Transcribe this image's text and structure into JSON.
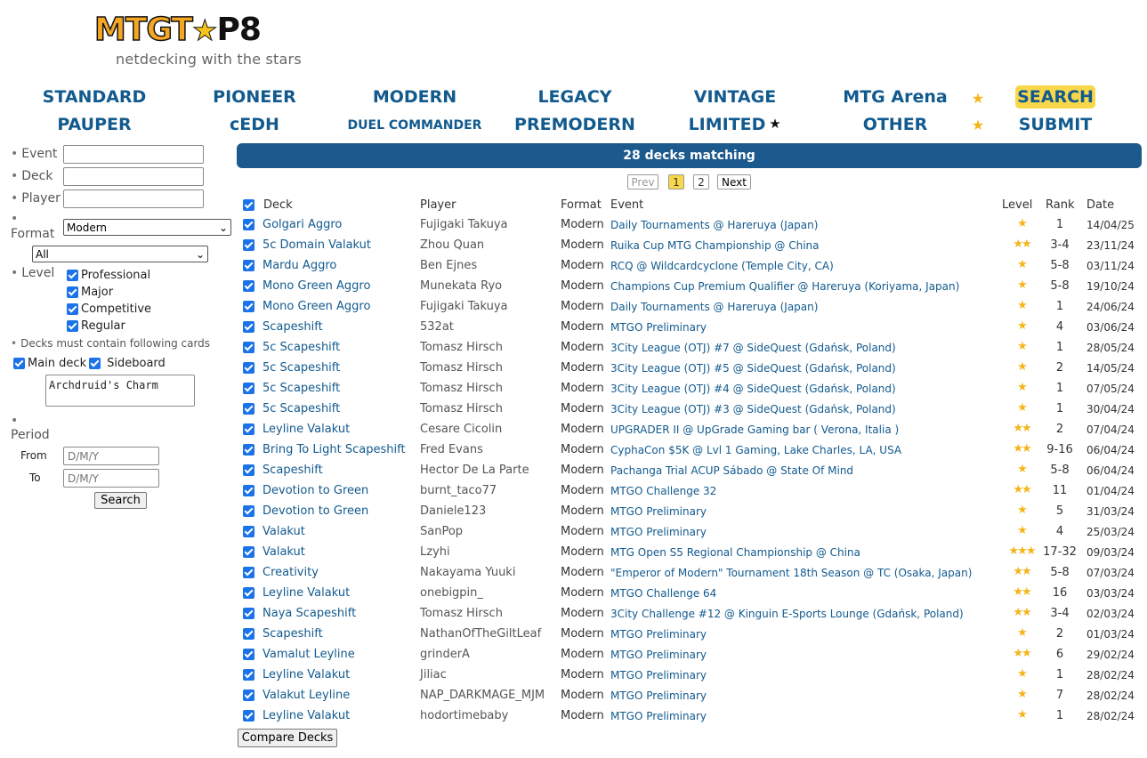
{
  "logo": {
    "part1": "MTG",
    "part2": "T",
    "part3": "P8",
    "tagline": "netdecking with the stars"
  },
  "nav": {
    "row1": [
      "STANDARD",
      "PIONEER",
      "MODERN",
      "LEGACY",
      "VINTAGE",
      "MTG Arena",
      "SEARCH"
    ],
    "row2": [
      "PAUPER",
      "cEDH",
      "DUEL COMMANDER",
      "PREMODERN",
      "LIMITED",
      "OTHER",
      "SUBMIT"
    ]
  },
  "sidebar": {
    "event_label": "Event",
    "deck_label": "Deck",
    "player_label": "Player",
    "format_label": "Format",
    "format_value": "Modern",
    "subformat_value": "All",
    "level_label": "Level",
    "levels": [
      "Professional",
      "Major",
      "Competitive",
      "Regular"
    ],
    "cards_label": "Decks must contain following cards",
    "main_deck_label": "Main deck",
    "sideboard_label": "Sideboard",
    "cards_value": "Archdruid's Charm",
    "period_label": "Period",
    "from_label": "From",
    "to_label": "To",
    "date_placeholder": "D/M/Y",
    "search_button": "Search"
  },
  "results": {
    "banner": "28 decks matching",
    "pagination": {
      "prev": "Prev",
      "page1": "1",
      "page2": "2",
      "next": "Next"
    },
    "headers": {
      "deck": "Deck",
      "player": "Player",
      "format": "Format",
      "event": "Event",
      "level": "Level",
      "rank": "Rank",
      "date": "Date"
    },
    "rows": [
      {
        "deck": "Golgari Aggro",
        "player": "Fujigaki Takuya",
        "format": "Modern",
        "event": "Daily Tournaments @ Hareruya (Japan)",
        "level": "★",
        "rank": "1",
        "date": "14/04/25"
      },
      {
        "deck": "5c Domain Valakut",
        "player": "Zhou Quan",
        "format": "Modern",
        "event": "Ruika Cup MTG Championship @ China",
        "level": "★★",
        "rank": "3-4",
        "date": "23/11/24"
      },
      {
        "deck": "Mardu Aggro",
        "player": "Ben Ejnes",
        "format": "Modern",
        "event": "RCQ @ Wildcardcyclone (Temple City, CA)",
        "level": "★",
        "rank": "5-8",
        "date": "03/11/24"
      },
      {
        "deck": "Mono Green Aggro",
        "player": "Munekata Ryo",
        "format": "Modern",
        "event": "Champions Cup Premium Qualifier @ Hareruya (Koriyama, Japan)",
        "level": "★",
        "rank": "5-8",
        "date": "19/10/24"
      },
      {
        "deck": "Mono Green Aggro",
        "player": "Fujigaki Takuya",
        "format": "Modern",
        "event": "Daily Tournaments @ Hareruya (Japan)",
        "level": "★",
        "rank": "1",
        "date": "24/06/24"
      },
      {
        "deck": "Scapeshift",
        "player": "532at",
        "format": "Modern",
        "event": "MTGO Preliminary",
        "level": "★",
        "rank": "4",
        "date": "03/06/24"
      },
      {
        "deck": "5c Scapeshift",
        "player": "Tomasz Hirsch",
        "format": "Modern",
        "event": "3City League (OTJ) #7 @ SideQuest (Gdańsk, Poland)",
        "level": "★",
        "rank": "1",
        "date": "28/05/24"
      },
      {
        "deck": "5c Scapeshift",
        "player": "Tomasz Hirsch",
        "format": "Modern",
        "event": "3City League (OTJ) #5 @ SideQuest (Gdańsk, Poland)",
        "level": "★",
        "rank": "2",
        "date": "14/05/24"
      },
      {
        "deck": "5c Scapeshift",
        "player": "Tomasz Hirsch",
        "format": "Modern",
        "event": "3City League (OTJ) #4 @ SideQuest (Gdańsk, Poland)",
        "level": "★",
        "rank": "1",
        "date": "07/05/24"
      },
      {
        "deck": "5c Scapeshift",
        "player": "Tomasz Hirsch",
        "format": "Modern",
        "event": "3City League (OTJ) #3 @ SideQuest (Gdańsk, Poland)",
        "level": "★",
        "rank": "1",
        "date": "30/04/24"
      },
      {
        "deck": "Leyline Valakut",
        "player": "Cesare Cicolin",
        "format": "Modern",
        "event": "UPGRADER II @ UpGrade Gaming bar ( Verona, Italia )",
        "level": "★★",
        "rank": "2",
        "date": "07/04/24"
      },
      {
        "deck": "Bring To Light Scapeshift",
        "player": "Fred Evans",
        "format": "Modern",
        "event": "CyphaCon $5K @ Lvl 1 Gaming, Lake Charles, LA, USA",
        "level": "★★",
        "rank": "9-16",
        "date": "06/04/24"
      },
      {
        "deck": "Scapeshift",
        "player": "Hector De La Parte",
        "format": "Modern",
        "event": "Pachanga Trial ACUP Sábado @ State Of Mind",
        "level": "★",
        "rank": "5-8",
        "date": "06/04/24"
      },
      {
        "deck": "Devotion to Green",
        "player": "burnt_taco77",
        "format": "Modern",
        "event": "MTGO Challenge 32",
        "level": "★★",
        "rank": "11",
        "date": "01/04/24"
      },
      {
        "deck": "Devotion to Green",
        "player": "Daniele123",
        "format": "Modern",
        "event": "MTGO Preliminary",
        "level": "★",
        "rank": "5",
        "date": "31/03/24"
      },
      {
        "deck": "Valakut",
        "player": "SanPop",
        "format": "Modern",
        "event": "MTGO Preliminary",
        "level": "★",
        "rank": "4",
        "date": "25/03/24"
      },
      {
        "deck": "Valakut",
        "player": "Lzyhi",
        "format": "Modern",
        "event": "MTG Open S5 Regional Championship @ China",
        "level": "★★★",
        "rank": "17-32",
        "date": "09/03/24"
      },
      {
        "deck": "Creativity",
        "player": "Nakayama Yuuki",
        "format": "Modern",
        "event": "\"Emperor of Modern\" Tournament 18th Season @ TC (Osaka, Japan)",
        "level": "★★",
        "rank": "5-8",
        "date": "07/03/24"
      },
      {
        "deck": "Leyline Valakut",
        "player": "onebigpin_",
        "format": "Modern",
        "event": "MTGO Challenge 64",
        "level": "★★",
        "rank": "16",
        "date": "03/03/24"
      },
      {
        "deck": "Naya Scapeshift",
        "player": "Tomasz Hirsch",
        "format": "Modern",
        "event": "3City Challenge #12 @ Kinguin E-Sports Lounge (Gdańsk, Poland)",
        "level": "★★",
        "rank": "3-4",
        "date": "02/03/24"
      },
      {
        "deck": "Scapeshift",
        "player": "NathanOfTheGiltLeaf",
        "format": "Modern",
        "event": "MTGO Preliminary",
        "level": "★",
        "rank": "2",
        "date": "01/03/24"
      },
      {
        "deck": "Vamalut Leyline",
        "player": "grinderA",
        "format": "Modern",
        "event": "MTGO Preliminary",
        "level": "★★",
        "rank": "6",
        "date": "29/02/24"
      },
      {
        "deck": "Leyline Valakut",
        "player": "Jiliac",
        "format": "Modern",
        "event": "MTGO Preliminary",
        "level": "★",
        "rank": "1",
        "date": "28/02/24"
      },
      {
        "deck": "Valakut Leyline",
        "player": "NAP_DARKMAGE_MJM",
        "format": "Modern",
        "event": "MTGO Preliminary",
        "level": "★",
        "rank": "7",
        "date": "28/02/24"
      },
      {
        "deck": "Leyline Valakut",
        "player": "hodortimebaby",
        "format": "Modern",
        "event": "MTGO Preliminary",
        "level": "★",
        "rank": "1",
        "date": "28/02/24"
      }
    ],
    "compare_button": "Compare Decks"
  }
}
